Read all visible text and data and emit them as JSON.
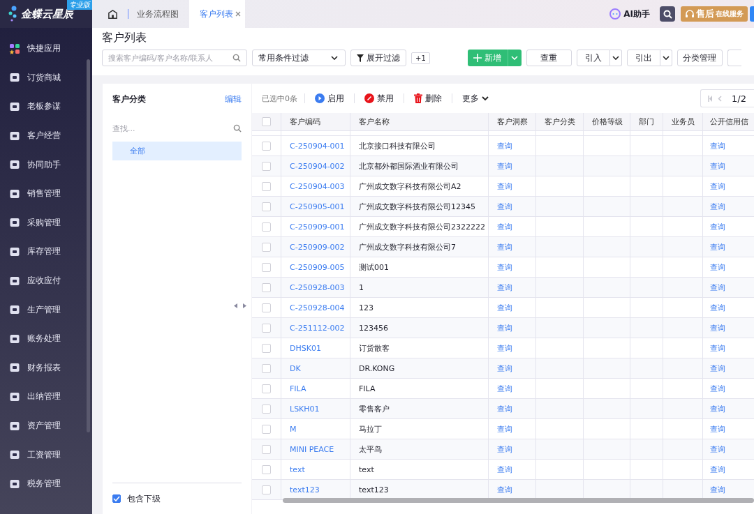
{
  "brand": {
    "name": "金蝶云星辰",
    "badge": "专业版"
  },
  "sidebar": {
    "items": [
      {
        "label": "快捷应用"
      },
      {
        "label": "订货商城"
      },
      {
        "label": "老板参谋"
      },
      {
        "label": "客户经营"
      },
      {
        "label": "协同助手"
      },
      {
        "label": "销售管理"
      },
      {
        "label": "采购管理"
      },
      {
        "label": "库存管理"
      },
      {
        "label": "应收应付"
      },
      {
        "label": "生产管理"
      },
      {
        "label": "账务处理"
      },
      {
        "label": "财务报表"
      },
      {
        "label": "出纳管理"
      },
      {
        "label": "资产管理"
      },
      {
        "label": "工资管理"
      },
      {
        "label": "税务管理"
      }
    ]
  },
  "tabs": [
    {
      "label": "业务流程图",
      "selected": false,
      "closable": false
    },
    {
      "label": "客户列表",
      "selected": true,
      "closable": true
    }
  ],
  "top_actions": {
    "ai": "AI助手",
    "service": "售后",
    "service_sub": "在线服务"
  },
  "page_title": "客户列表",
  "filters": {
    "search_placeholder": "搜索客户编码/客户名称/联系人",
    "preset": "常用条件过滤",
    "expand": "展开过滤",
    "count": "+1"
  },
  "actions": [
    {
      "label": "新增",
      "kind": "primary"
    },
    {
      "label": "查重",
      "kind": "plain"
    },
    {
      "label": "引入",
      "kind": "split"
    },
    {
      "label": "引出",
      "kind": "split"
    },
    {
      "label": "分类管理",
      "kind": "plain"
    }
  ],
  "category_panel": {
    "title": "客户分类",
    "edit": "编辑",
    "search_placeholder": "查找...",
    "items": [
      {
        "label": "全部",
        "selected": true
      }
    ],
    "include_children": {
      "label": "包含下级",
      "checked": true
    }
  },
  "table_toolbar": {
    "selected_count": "已选中0条",
    "buttons": [
      {
        "label": "启用",
        "kind": "enable"
      },
      {
        "label": "禁用",
        "kind": "disable"
      },
      {
        "label": "删除",
        "kind": "delete"
      },
      {
        "label": "更多",
        "kind": "more"
      }
    ],
    "page": "1/2"
  },
  "table": {
    "all_checked": false,
    "columns": [
      "客户编码",
      "客户名称",
      "客户洞察",
      "客户分类",
      "价格等级",
      "部门",
      "业务员",
      "公开信用信"
    ],
    "rows": [
      {
        "code": "C-250904-001",
        "name": "北京接口科技有限公司",
        "insight": "查询",
        "credit": "查询",
        "checked": false
      },
      {
        "code": "C-250904-002",
        "name": "北京都外都国际酒业有限公司",
        "insight": "查询",
        "credit": "查询",
        "checked": false
      },
      {
        "code": "C-250904-003",
        "name": "广州成文数字科技有限公司A2",
        "insight": "查询",
        "credit": "查询",
        "checked": false
      },
      {
        "code": "C-250905-001",
        "name": "广州成文数字科技有限公司12345",
        "insight": "查询",
        "credit": "查询",
        "checked": false
      },
      {
        "code": "C-250909-001",
        "name": "广州成文数字科技有限公司2322222",
        "insight": "查询",
        "credit": "查询",
        "checked": false
      },
      {
        "code": "C-250909-002",
        "name": "广州成文数字科技有限公司7",
        "insight": "查询",
        "credit": "查询",
        "checked": false
      },
      {
        "code": "C-250909-005",
        "name": "测试001",
        "insight": "查询",
        "credit": "查询",
        "checked": false
      },
      {
        "code": "C-250928-003",
        "name": "1",
        "insight": "查询",
        "credit": "查询",
        "checked": false
      },
      {
        "code": "C-250928-004",
        "name": "123",
        "insight": "查询",
        "credit": "查询",
        "checked": false
      },
      {
        "code": "C-251112-002",
        "name": "123456",
        "insight": "查询",
        "credit": "查询",
        "checked": false
      },
      {
        "code": "DHSK01",
        "name": "订货散客",
        "insight": "查询",
        "credit": "查询",
        "checked": false
      },
      {
        "code": "DK",
        "name": "DR.KONG",
        "insight": "查询",
        "credit": "查询",
        "checked": false
      },
      {
        "code": "FILA",
        "name": "FILA",
        "insight": "查询",
        "credit": "查询",
        "checked": false
      },
      {
        "code": "LSKH01",
        "name": "零售客户",
        "insight": "查询",
        "credit": "查询",
        "checked": false
      },
      {
        "code": "M",
        "name": "马拉丁",
        "insight": "查询",
        "credit": "查询",
        "checked": false
      },
      {
        "code": "MINI PEACE",
        "name": "太平鸟",
        "insight": "查询",
        "credit": "查询",
        "checked": false
      },
      {
        "code": "text",
        "name": "text",
        "insight": "查询",
        "credit": "查询",
        "checked": false
      },
      {
        "code": "text123",
        "name": "text123",
        "insight": "查询",
        "credit": "查询",
        "checked": false
      }
    ]
  }
}
